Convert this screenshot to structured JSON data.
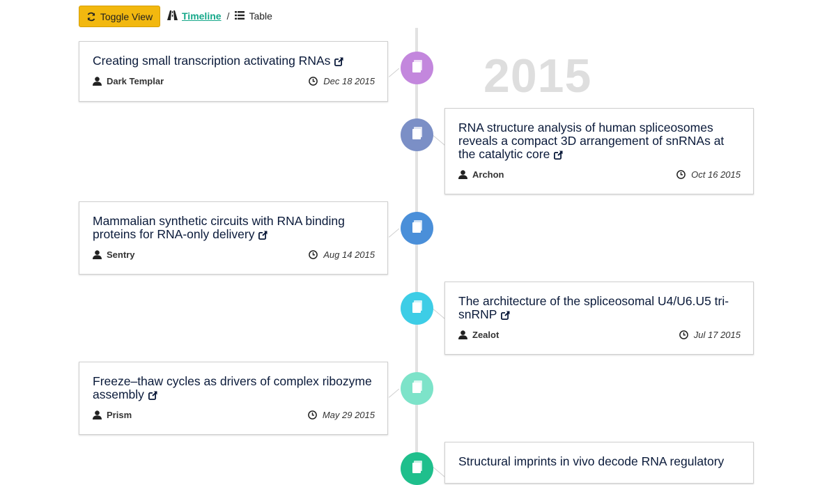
{
  "toolbar": {
    "toggle_label": "Toggle View",
    "timeline_label": "Timeline",
    "separator": "/",
    "table_label": "Table"
  },
  "timeline": {
    "year": "2015",
    "items": [
      {
        "title": "Creating small transcription activating RNAs",
        "author": "Dark Templar",
        "date": "Dec 18 2015",
        "color": "#c387dd"
      },
      {
        "title": "RNA structure analysis of human spliceosomes reveals a compact 3D arrangement of snRNAs at the catalytic core",
        "author": "Archon",
        "date": "Oct 16 2015",
        "color": "#7b8fc6"
      },
      {
        "title": "Mammalian synthetic circuits with RNA binding proteins for RNA-only delivery",
        "author": "Sentry",
        "date": "Aug 14 2015",
        "color": "#4a8fd9"
      },
      {
        "title": "The architecture of the spliceosomal U4/U6.U5 tri-snRNP",
        "author": "Zealot",
        "date": "Jul 17 2015",
        "color": "#3dcde6"
      },
      {
        "title": "Freeze–thaw cycles as drivers of complex ribozyme assembly",
        "author": "Prism",
        "date": "May 29 2015",
        "color": "#7de3c9"
      },
      {
        "title": "Structural imprints in vivo decode RNA regulatory",
        "author": "",
        "date": "",
        "color": "#1fbf8c"
      }
    ]
  }
}
